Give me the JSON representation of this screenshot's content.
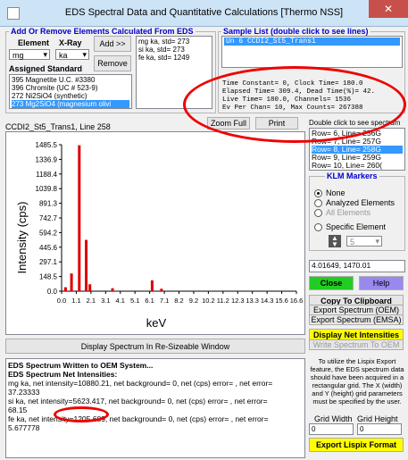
{
  "window": {
    "title": "EDS Spectral Data and Quantitative Calculations [Thermo NSS]",
    "close": "✕"
  },
  "elements_group": {
    "title": "Add Or Remove Elements Calculated From EDS",
    "element_label": "Element",
    "xray_label": "X-Ray",
    "element_value": "mg",
    "xray_value": "ka",
    "add_label": "Add >>",
    "remove_label": "Remove",
    "assigned_label": "Assigned Standard",
    "standards": [
      "395 Magnetite U.C. #3380",
      "396 Chromite (UC # 523-9)",
      "272 Ni2SiO4 (synthetic)",
      "273 Mg2SiO4 (magnesium olivi"
    ],
    "selected_std": 3,
    "elements": [
      "mg ka, std= 273",
      "si ka, std= 273",
      "fe ka, std= 1249"
    ]
  },
  "sample_group": {
    "title": "Sample List (double click to see lines)",
    "sample": "Un    6  CCDI2_St5_Trans1",
    "info": [
      "Time Constant=      0,  Clock Time= 180.0",
      "Elapsed Time= 309.4, Dead Time(%)=   42.",
      "Live Time= 180.0,          Channels=  1536",
      "Ev Per Chan=    10,  Max Counts=  267388"
    ]
  },
  "spectrum": {
    "header": "CCDI2_St5_Trans1, Line 258",
    "zoom_label": "Zoom Full",
    "print_label": "Print",
    "double_click_label": "Double click to see spectrum",
    "rows": [
      "Row= 6, Line= 256G",
      "Row= 7, Line= 257G",
      "Row= 8, Line= 258G",
      "Row= 9, Line= 259G",
      "Row= 10, Line= 260("
    ],
    "selected_row": 2,
    "display_resizable": "Display Spectrum In Re-Sizeable Window"
  },
  "chart_data": {
    "type": "line",
    "title": "",
    "xlabel": "keV",
    "ylabel": "Intensity (cps)",
    "xticks": [
      "0.0",
      "1.1",
      "2.1",
      "3.1",
      "4.1",
      "5.1",
      "6.1",
      "7.1",
      "8.2",
      "9.2",
      "10.2",
      "11.2",
      "12.3",
      "13.3",
      "14.3",
      "15.6",
      "16.6"
    ],
    "yticks": [
      "1485.5",
      "1336.9",
      "1188.4",
      "1039.8",
      "891.3",
      "742.7",
      "594.2",
      "445.6",
      "297.1",
      "148.5",
      "0.0"
    ],
    "xlim": [
      0,
      16.6
    ],
    "ylim": [
      0,
      1485.5
    ],
    "peaks": [
      {
        "x": 0.28,
        "y": 40
      },
      {
        "x": 0.7,
        "y": 180
      },
      {
        "x": 1.25,
        "y": 1480
      },
      {
        "x": 1.74,
        "y": 520
      },
      {
        "x": 2.0,
        "y": 70
      },
      {
        "x": 3.6,
        "y": 30
      },
      {
        "x": 6.4,
        "y": 110
      },
      {
        "x": 7.06,
        "y": 25
      }
    ]
  },
  "klm": {
    "title": "KLM Markers",
    "none": "None",
    "analyzed": "Analyzed Elements",
    "all": "All Elements",
    "specific": "Specific Element",
    "specific_value": "5"
  },
  "coords": "4.01649,  1470.01",
  "buttons": {
    "close": "Close",
    "help": "Help",
    "copy": "Copy To Clipboard",
    "export_oem": "Export Spectrum (OEM)",
    "export_emsa": "Export Spectrum (EMSA)",
    "display_net": "Display Net Intensities",
    "write_oem": "Write Spectrum To OEM"
  },
  "status_lines": [
    "EDS Spectrum Written to OEM System...",
    "EDS Spectrum Net Intensities:",
    "mg ka, net intensity=10880.21, net background= 0, net (cps) error= , net error=",
    "37.23333",
    "si ka, net intensity=5623.417, net background= 0, net (cps) error= , net error=",
    "68.15",
    "fe ka, net intensity=1205.689, net background= 0, net (cps) error= , net error=",
    "5.677778"
  ],
  "lispix": {
    "note": "To utilize the Lispix Export feature, the EDS spectrum data should have been acquired in a rectangular grid. The X (width) and Y (height) grid parameters must be specified by the user.",
    "width_label": "Grid Width",
    "height_label": "Grid Height",
    "width_value": "0",
    "height_value": "0",
    "export_label": "Export Lispix Format"
  },
  "colors": {
    "accent": "#3399ff",
    "annotation": "#e00000",
    "plot": "#dd0000",
    "close_btn": "#22cc22",
    "help_btn": "#9988ee",
    "highlight": "#ffff00"
  }
}
